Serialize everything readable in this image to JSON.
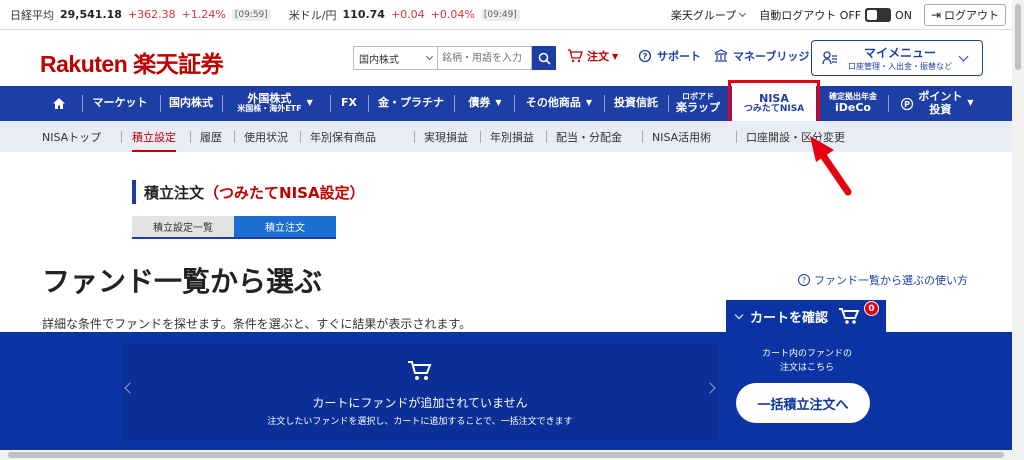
{
  "ticker": {
    "nikkei": {
      "label": "日経平均",
      "value": "29,541.18",
      "change": "+362.38",
      "pct": "+1.24%",
      "time": "[09:59]"
    },
    "usdjpy": {
      "label": "米ドル/円",
      "value": "110.74",
      "change": "+0.04",
      "pct": "+0.04%",
      "time": "[09:49]"
    },
    "group": "楽天グループ",
    "auto_logout": "自動ログアウト OFF",
    "on": "ON",
    "logout": "ログアウト"
  },
  "header": {
    "logo": "Rakuten 楽天証券",
    "search_select": "国内株式",
    "search_placeholder": "銘柄・用語を入力",
    "order": "注文",
    "support": "サポート",
    "bridge": "マネーブリッジ",
    "mymenu_title": "マイメニュー",
    "mymenu_sub": "口座管理・入出金・振替など"
  },
  "mainnav": {
    "market": "マーケット",
    "domestic": "国内株式",
    "foreign1": "外国株式",
    "foreign2": "米国株・海外ETF",
    "fx": "FX",
    "gold": "金・プラチナ",
    "bond": "債券",
    "other": "その他商品",
    "trust": "投資信託",
    "robo1": "ロボアド",
    "robo2": "楽ラップ",
    "nisa1": "NISA",
    "nisa2": "つみたてNISA",
    "ideco1": "確定拠出年金",
    "ideco2": "iDeCo",
    "point1": "ポイント",
    "point2": "投資"
  },
  "subnav": [
    "NISAトップ",
    "積立設定",
    "履歴",
    "使用状況",
    "年別保有商品",
    "実現損益",
    "年別損益",
    "配当・分配金",
    "NISA活用術",
    "口座開設・区分変更"
  ],
  "content": {
    "title": "積立注文",
    "title_red": "（つみたてNISA設定）",
    "tab1": "積立設定一覧",
    "tab2": "積立注文",
    "heading": "ファンド一覧から選ぶ",
    "howto": "ファンド一覧から選ぶの使い方",
    "desc": "詳細な条件でファンドを探せます。条件を選ぶと、すぐに結果が表示されます。"
  },
  "cart": {
    "empty_title": "カートにファンドが追加されていません",
    "empty_sub": "注文したいファンドを選択し、カートに追加することで、一括注文できます",
    "confirm": "カートを確認",
    "count": "0",
    "info1": "カート内のファンドの",
    "info2": "注文はこちら",
    "bulk": "一括積立注文へ"
  },
  "colors": {
    "brand_red": "#bf0000",
    "nav_blue": "#1d3fa5",
    "highlight": "#e60012",
    "panel_blue": "#0b33a3"
  }
}
